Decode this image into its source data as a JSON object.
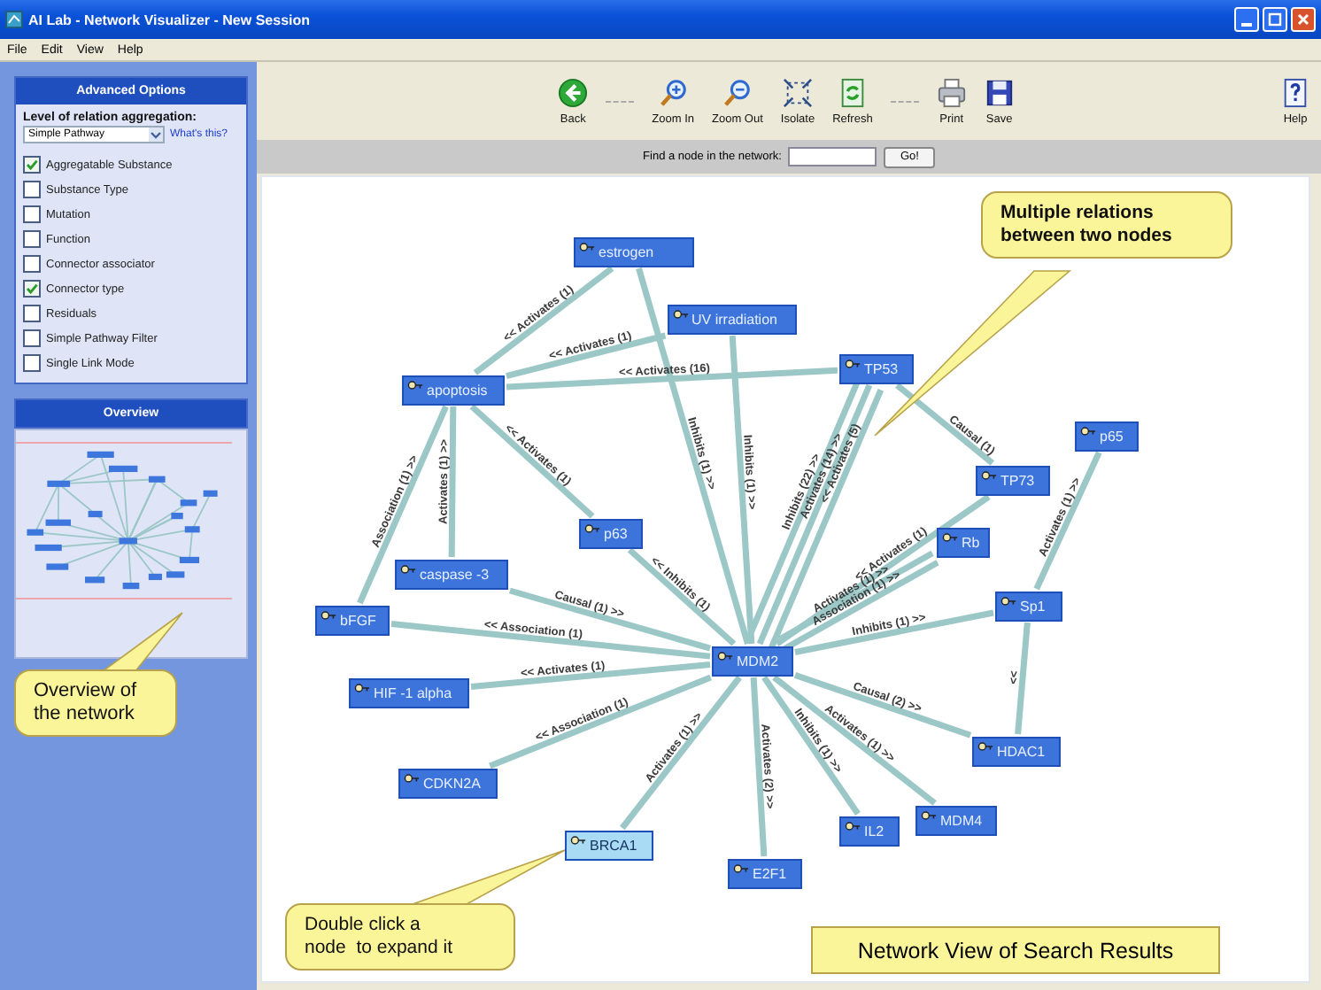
{
  "window": {
    "title": "AI Lab - Network Visualizer - New Session"
  },
  "menu": [
    "File",
    "Edit",
    "View",
    "Help"
  ],
  "sidebar": {
    "advanced_options": {
      "title": "Advanced Options",
      "aggregation_label": "Level of relation aggregation:",
      "aggregation_value": "Simple Pathway",
      "help_link": "What's this?",
      "options": [
        {
          "label": "Aggregatable Substance",
          "checked": true
        },
        {
          "label": "Substance Type",
          "checked": false
        },
        {
          "label": "Mutation",
          "checked": false
        },
        {
          "label": "Function",
          "checked": false
        },
        {
          "label": "Connector associator",
          "checked": false
        },
        {
          "label": "Connector type",
          "checked": true
        },
        {
          "label": "Residuals",
          "checked": false
        },
        {
          "label": "Simple Pathway Filter",
          "checked": false
        },
        {
          "label": "Single Link Mode",
          "checked": false
        }
      ]
    },
    "overview": {
      "title": "Overview",
      "callout": "Overview of the network"
    }
  },
  "toolbar": [
    {
      "label": "Back",
      "kind": "back"
    },
    {
      "label": "Zoom In",
      "kind": "zoom-in"
    },
    {
      "label": "Zoom Out",
      "kind": "zoom-out"
    },
    {
      "label": "Isolate",
      "kind": "isolate"
    },
    {
      "label": "Refresh",
      "kind": "refresh"
    },
    {
      "label": "Print",
      "kind": "print"
    },
    {
      "label": "Save",
      "kind": "save"
    },
    {
      "label": "Help",
      "kind": "help"
    }
  ],
  "find": {
    "label": "Find a node in the network:",
    "button": "Go!"
  },
  "network": {
    "nodes": [
      {
        "label": "estrogen",
        "selected": false
      },
      {
        "label": "UV irradiation",
        "selected": false
      },
      {
        "label": "apoptosis",
        "selected": false
      },
      {
        "label": "TP53",
        "selected": false
      },
      {
        "label": "p65",
        "selected": false
      },
      {
        "label": "TP73",
        "selected": false
      },
      {
        "label": "Rb",
        "selected": false
      },
      {
        "label": "p63",
        "selected": false
      },
      {
        "label": "caspase -3",
        "selected": false
      },
      {
        "label": "Sp1",
        "selected": false
      },
      {
        "label": "bFGF",
        "selected": false
      },
      {
        "label": "MDM2",
        "selected": false
      },
      {
        "label": "HIF -1 alpha",
        "selected": false
      },
      {
        "label": "HDAC1",
        "selected": false
      },
      {
        "label": "CDKN2A",
        "selected": false
      },
      {
        "label": "IL2",
        "selected": false
      },
      {
        "label": "MDM4",
        "selected": false
      },
      {
        "label": "BRCA1",
        "selected": true
      },
      {
        "label": "E2F1",
        "selected": false
      }
    ],
    "relations": [
      {
        "label": "<< Activates (1)"
      },
      {
        "label": "<< Activates (1)"
      },
      {
        "label": "<< Activates (16)"
      },
      {
        "label": "Inhibits (1) >>"
      },
      {
        "label": "Inhibits (1) >>"
      },
      {
        "label": "<< Activates (1)"
      },
      {
        "label": "Activates (1) >>"
      },
      {
        "label": "Association (1) >>"
      },
      {
        "label": "<< Inhibits (1)"
      },
      {
        "label": "Causal (1) >>"
      },
      {
        "label": "<< Association (1)"
      },
      {
        "label": "<< Activates (1)"
      },
      {
        "label": "<< Association (1)"
      },
      {
        "label": "Activates (1) >>"
      },
      {
        "label": "Activates (2) >>"
      },
      {
        "label": "Inhibits (1) >>"
      },
      {
        "label": "Activates (1) >>"
      },
      {
        "label": "Causal (2) >>"
      },
      {
        "label": "Inhibits (1) >>"
      },
      {
        "label": "<<"
      },
      {
        "label": "Activates (1) >>"
      },
      {
        "label": "Causal (1)"
      },
      {
        "label": "Inhibits (22) >>"
      },
      {
        "label": "Activates (14) >>"
      },
      {
        "label": "<< Activates (5)"
      },
      {
        "label": "<< Activates (1)"
      },
      {
        "label": "Activates (1) >>"
      },
      {
        "label": "Association (1) >>"
      }
    ],
    "callouts": [
      "Multiple relations between two nodes",
      "Double click a node  to expand it"
    ],
    "caption": "Network View of Search Results"
  }
}
